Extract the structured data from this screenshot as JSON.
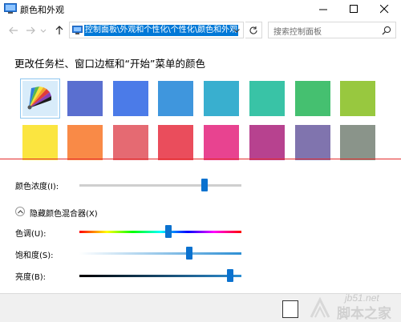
{
  "window": {
    "title": "颜色和外观",
    "controls": {
      "minimize_icon": "minimize-icon",
      "maximize_icon": "maximize-icon",
      "close_icon": "close-icon"
    }
  },
  "address_bar": {
    "path": "控制面板\\外观和个性化\\个性化\\颜色和外观",
    "search_placeholder": "搜索控制面板"
  },
  "heading": "更改任务栏、窗口边框和“开始”菜单的颜色",
  "swatches": [
    {
      "color": "#palette",
      "selected": true
    },
    {
      "color": "#5a6fd0"
    },
    {
      "color": "#4b7be8"
    },
    {
      "color": "#3f96dd"
    },
    {
      "color": "#39afcf"
    },
    {
      "color": "#39c3a6"
    },
    {
      "color": "#45c070"
    },
    {
      "color": "#98c83f"
    },
    {
      "color": "#fbe540"
    },
    {
      "color": "#f98a47"
    },
    {
      "color": "#e56a72"
    },
    {
      "color": "#ea4d5c"
    },
    {
      "color": "#e84390"
    },
    {
      "color": "#b7428f"
    },
    {
      "color": "#8074ae"
    },
    {
      "color": "#8a948a"
    }
  ],
  "sliders": {
    "intensity": {
      "label": "颜色浓度(I):",
      "value": 0.77
    },
    "mixer_toggle": "隐藏颜色混合器(X)",
    "hue": {
      "label": "色调(U):",
      "value": 0.55
    },
    "saturation": {
      "label": "饱和度(S):",
      "value": 0.68
    },
    "brightness": {
      "label": "亮度(B):",
      "value": 0.93
    }
  },
  "watermark": {
    "site": "jb51.net",
    "text": "脚本之家"
  }
}
